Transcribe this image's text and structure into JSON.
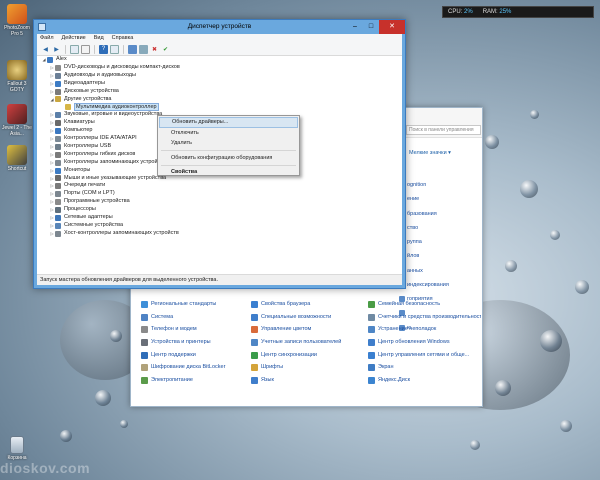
{
  "gadget": {
    "cpu_label": "CPU:",
    "cpu_value": "2%",
    "ram_label": "RAM:",
    "ram_value": "25%"
  },
  "desktop_icons": [
    "PhotoZoom Pro 5",
    "Fallout 3 GOTY",
    "Jewel 2 - The Asia...",
    "Shortcut",
    "Корзина"
  ],
  "watermark": "dioskov.com",
  "device_manager": {
    "title": "Диспетчер устройств",
    "menu": [
      "Файл",
      "Действие",
      "Вид",
      "Справка"
    ],
    "root": "Alex",
    "tree": [
      {
        "label": "DVD-дисководы и дисководы компакт-дисков",
        "level": 1,
        "exp": "closed",
        "color": "#8a8a8a"
      },
      {
        "label": "Аудиовходы и аудиовыходы",
        "level": 1,
        "exp": "closed",
        "color": "#6b7f96"
      },
      {
        "label": "Видеоадаптеры",
        "level": 1,
        "exp": "closed",
        "color": "#3d7cc4"
      },
      {
        "label": "Дисковые устройства",
        "level": 1,
        "exp": "closed",
        "color": "#7a7a7a"
      },
      {
        "label": "Другие устройства",
        "level": 1,
        "exp": "open",
        "color": "#c9a640"
      },
      {
        "label": "Мультимедиа аудиоконтроллер",
        "level": 2,
        "exp": "none",
        "color": "#d7b647",
        "selected": true
      },
      {
        "label": "Звуковые, игровые и видеоустройства",
        "level": 1,
        "exp": "closed",
        "color": "#5b7fa8"
      },
      {
        "label": "Клавиатуры",
        "level": 1,
        "exp": "closed",
        "color": "#6a6a6a"
      },
      {
        "label": "Компьютер",
        "level": 1,
        "exp": "closed",
        "color": "#3b78c1"
      },
      {
        "label": "Контроллеры IDE ATA/ATAPI",
        "level": 1,
        "exp": "closed",
        "color": "#7c8a96"
      },
      {
        "label": "Контроллеры USB",
        "level": 1,
        "exp": "closed",
        "color": "#6f7f8c"
      },
      {
        "label": "Контроллеры гибких дисков",
        "level": 1,
        "exp": "closed",
        "color": "#7a7a7a"
      },
      {
        "label": "Контроллеры запоминающих устройств",
        "level": 1,
        "exp": "closed",
        "color": "#7d8790"
      },
      {
        "label": "Мониторы",
        "level": 1,
        "exp": "closed",
        "color": "#3d7cc4"
      },
      {
        "label": "Мыши и иные указывающие устройства",
        "level": 1,
        "exp": "closed",
        "color": "#6a6a6a"
      },
      {
        "label": "Очереди печати",
        "level": 1,
        "exp": "closed",
        "color": "#7a7a7a"
      },
      {
        "label": "Порты (COM и LPT)",
        "level": 1,
        "exp": "closed",
        "color": "#7d8790"
      },
      {
        "label": "Программные устройства",
        "level": 1,
        "exp": "closed",
        "color": "#8a8a8a"
      },
      {
        "label": "Процессоры",
        "level": 1,
        "exp": "closed",
        "color": "#5f6f7c"
      },
      {
        "label": "Сетевые адаптеры",
        "level": 1,
        "exp": "closed",
        "color": "#3f77b8"
      },
      {
        "label": "Системные устройства",
        "level": 1,
        "exp": "closed",
        "color": "#5a86b8"
      },
      {
        "label": "Хост-контроллеры запоминающих устройств",
        "level": 1,
        "exp": "closed",
        "color": "#7d8790"
      }
    ],
    "status": "Запуск мастера обновления драйверов для выделенного устройства."
  },
  "context_menu": {
    "items": [
      "Обновить драйверы...",
      "Отключить",
      "Удалить",
      "Обновить конфигурацию оборудования",
      "Свойства"
    ]
  },
  "control_panel": {
    "search_placeholder": "Поиск в панели управления",
    "view_label": "Мелкие значки ▾",
    "right_column": [
      "ognition",
      "ение",
      "бразования",
      "ство",
      "руппа",
      "йлов",
      "анных",
      "индексирования",
      "гоприятия",
      "",
      "ю"
    ],
    "grid_items": [
      {
        "label": "Региональные стандарты",
        "color": "#3e8fd8"
      },
      {
        "label": "Свойства браузера",
        "color": "#3a7fd0"
      },
      {
        "label": "Семейная безопасность",
        "color": "#4a9c46"
      },
      {
        "label": "Система",
        "color": "#4f83c4"
      },
      {
        "label": "Специальные возможности",
        "color": "#3f7ecb"
      },
      {
        "label": "Счетчики и средства производительности",
        "color": "#6f8aa3"
      },
      {
        "label": "Телефон и модем",
        "color": "#8a8a8a"
      },
      {
        "label": "Управление цветом",
        "color": "#d96b3a"
      },
      {
        "label": "Устранение неполадок",
        "color": "#4e86c6"
      },
      {
        "label": "Устройства и принтеры",
        "color": "#6a6f78"
      },
      {
        "label": "Учетные записи пользователей",
        "color": "#4f86c5"
      },
      {
        "label": "Центр обновления Windows",
        "color": "#3f7ecb"
      },
      {
        "label": "Центр поддержки",
        "color": "#2f6db8"
      },
      {
        "label": "Центр синхронизации",
        "color": "#3a9c4a"
      },
      {
        "label": "Центр управления сетями и обще...",
        "color": "#3a7fd0"
      },
      {
        "label": "Шифрование диска BitLocker",
        "color": "#b0a27a"
      },
      {
        "label": "Шрифты",
        "color": "#d4a43a"
      },
      {
        "label": "Экран",
        "color": "#3e7cc4"
      },
      {
        "label": "Электропитание",
        "color": "#5b9b4a"
      },
      {
        "label": "Язык",
        "color": "#3f7ecb"
      },
      {
        "label": "Яндекс.Диск",
        "color": "#3b84d0"
      }
    ]
  }
}
